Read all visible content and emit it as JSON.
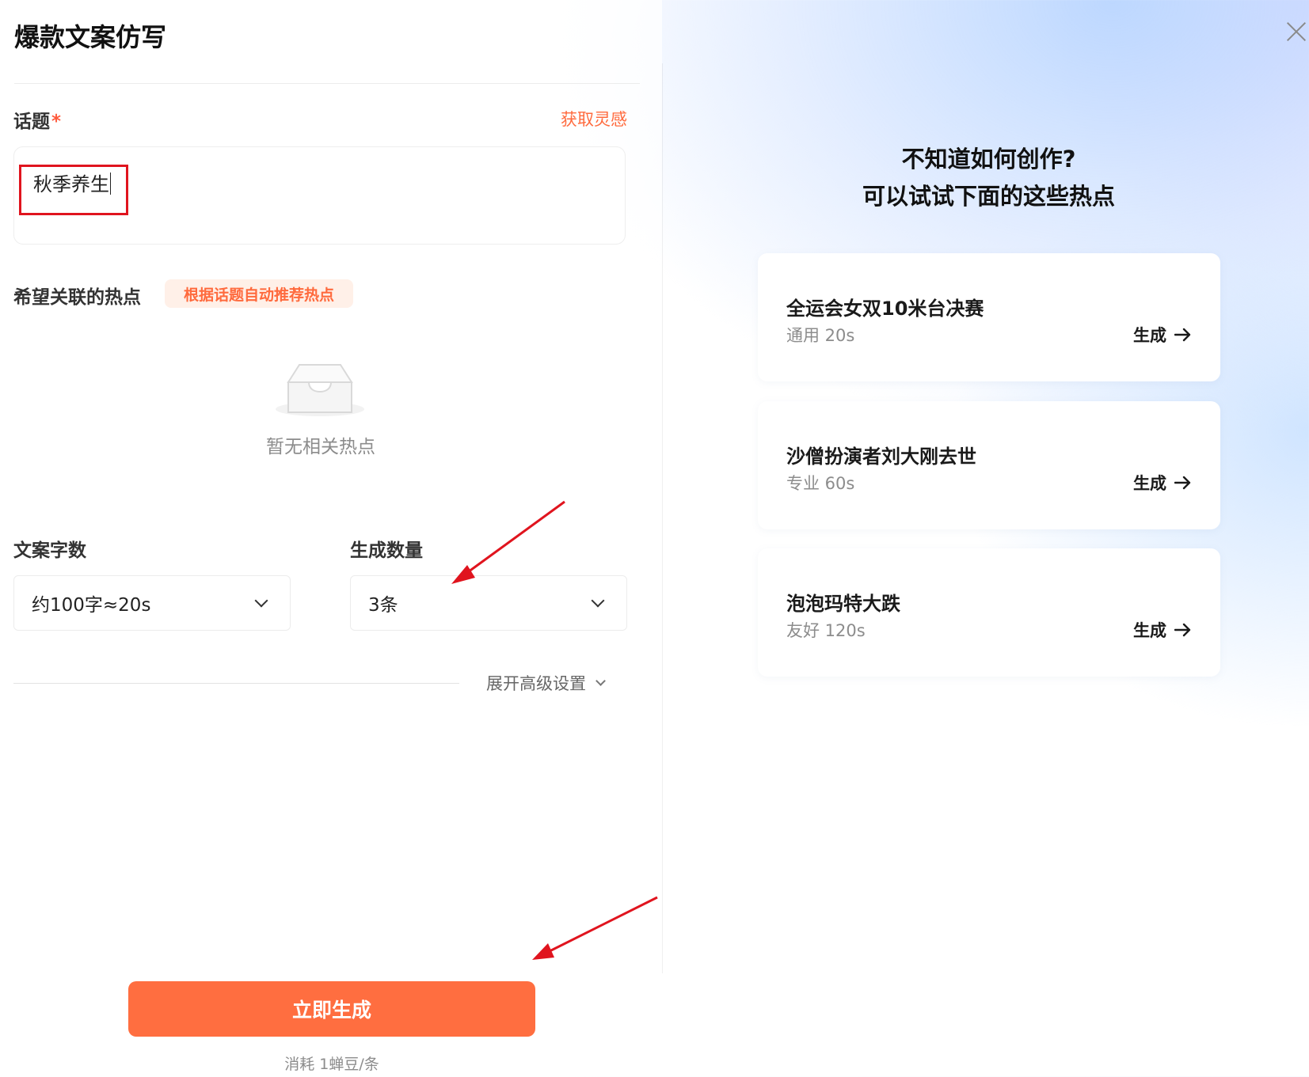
{
  "header": {
    "title": "爆款文案仿写"
  },
  "topic": {
    "label": "话题",
    "required_mark": "*",
    "inspire_link": "获取灵感",
    "value": "秋季养生"
  },
  "hotspot": {
    "label": "希望关联的热点",
    "auto_tag": "根据话题自动推荐热点",
    "empty_text": "暂无相关热点"
  },
  "word_count": {
    "label": "文案字数",
    "selected": "约100字≈20s"
  },
  "quantity": {
    "label": "生成数量",
    "selected": "3条"
  },
  "advanced": {
    "label": "展开高级设置"
  },
  "footer": {
    "generate_button": "立即生成",
    "cost_text": "消耗 1蝉豆/条"
  },
  "suggestions": {
    "heading_line1": "不知道如何创作?",
    "heading_line2": "可以试试下面的这些热点",
    "items": [
      {
        "title": "全运会女双10米台决赛",
        "subtitle": "通用 20s",
        "action": "生成"
      },
      {
        "title": "沙僧扮演者刘大刚去世",
        "subtitle": "专业 60s",
        "action": "生成"
      },
      {
        "title": "泡泡玛特大跌",
        "subtitle": "友好 120s",
        "action": "生成"
      }
    ]
  },
  "colors": {
    "accent": "#ff6e40",
    "accent_text": "#ff6a3d",
    "highlight_box": "#e0141e",
    "annotation_arrow": "#e0141e"
  },
  "icons": {
    "close": "close-icon",
    "empty": "empty-inbox-icon",
    "dropdown": "chevron-down-icon",
    "arrow": "arrow-right-icon"
  }
}
